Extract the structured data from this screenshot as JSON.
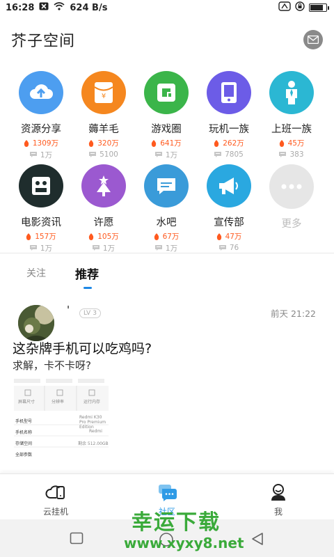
{
  "status_bar": {
    "time": "16:28",
    "speed": "624 B/s"
  },
  "header": {
    "title": "芥子空间"
  },
  "grid": [
    {
      "name": "资源分享",
      "hot": "1309万",
      "comments": "1万",
      "color": "#4d9ef0",
      "icon": "cloud-upload-icon"
    },
    {
      "name": "薅羊毛",
      "hot": "320万",
      "comments": "5100",
      "color": "#f5871f",
      "icon": "red-packet-icon"
    },
    {
      "name": "游戏圈",
      "hot": "641万",
      "comments": "1万",
      "color": "#3bb54a",
      "icon": "game-icon"
    },
    {
      "name": "玩机一族",
      "hot": "262万",
      "comments": "7805",
      "color": "#6c5ce7",
      "icon": "phone-icon"
    },
    {
      "name": "上班一族",
      "hot": "45万",
      "comments": "383",
      "color": "#2bb7d3",
      "icon": "worker-icon"
    },
    {
      "name": "电影资讯",
      "hot": "157万",
      "comments": "1万",
      "color": "#1f2d2d",
      "icon": "film-icon"
    },
    {
      "name": "许愿",
      "hot": "105万",
      "comments": "1万",
      "color": "#9b59d0",
      "icon": "tree-icon"
    },
    {
      "name": "水吧",
      "hot": "67万",
      "comments": "1万",
      "color": "#3a9bd9",
      "icon": "chat-icon"
    },
    {
      "name": "宣传部",
      "hot": "47万",
      "comments": "76",
      "color": "#2aa8e0",
      "icon": "megaphone-icon"
    },
    {
      "name": "更多",
      "hot": "",
      "comments": "",
      "color": "#e6e6e6",
      "icon": "more-icon"
    }
  ],
  "tabs": {
    "follow": "关注",
    "recommend": "推荐"
  },
  "post": {
    "username": "'",
    "level": "LV",
    "level_num": "3",
    "time": "前天 21:22",
    "title": "这杂牌手机可以吃鸡吗?",
    "subtitle": "求解，卡不卡呀?",
    "image_rows": {
      "r1a": "屏幕尺寸",
      "r1b": "分辨率",
      "r1c": "运行内存",
      "model_label": "手机型号",
      "model_value": "Redmi K30 Pro Premium Edition",
      "name_label": "手机名称",
      "name_value": "Redmi",
      "storage_label": "存储空间",
      "storage_value": "剩余 512.00GB",
      "all_label": "全部参数"
    }
  },
  "bottom_nav": {
    "cloud": "云挂机",
    "community": "社区",
    "me": "我"
  },
  "watermark": {
    "line1": "幸运下载",
    "line2": "www.xyxy8.net"
  }
}
